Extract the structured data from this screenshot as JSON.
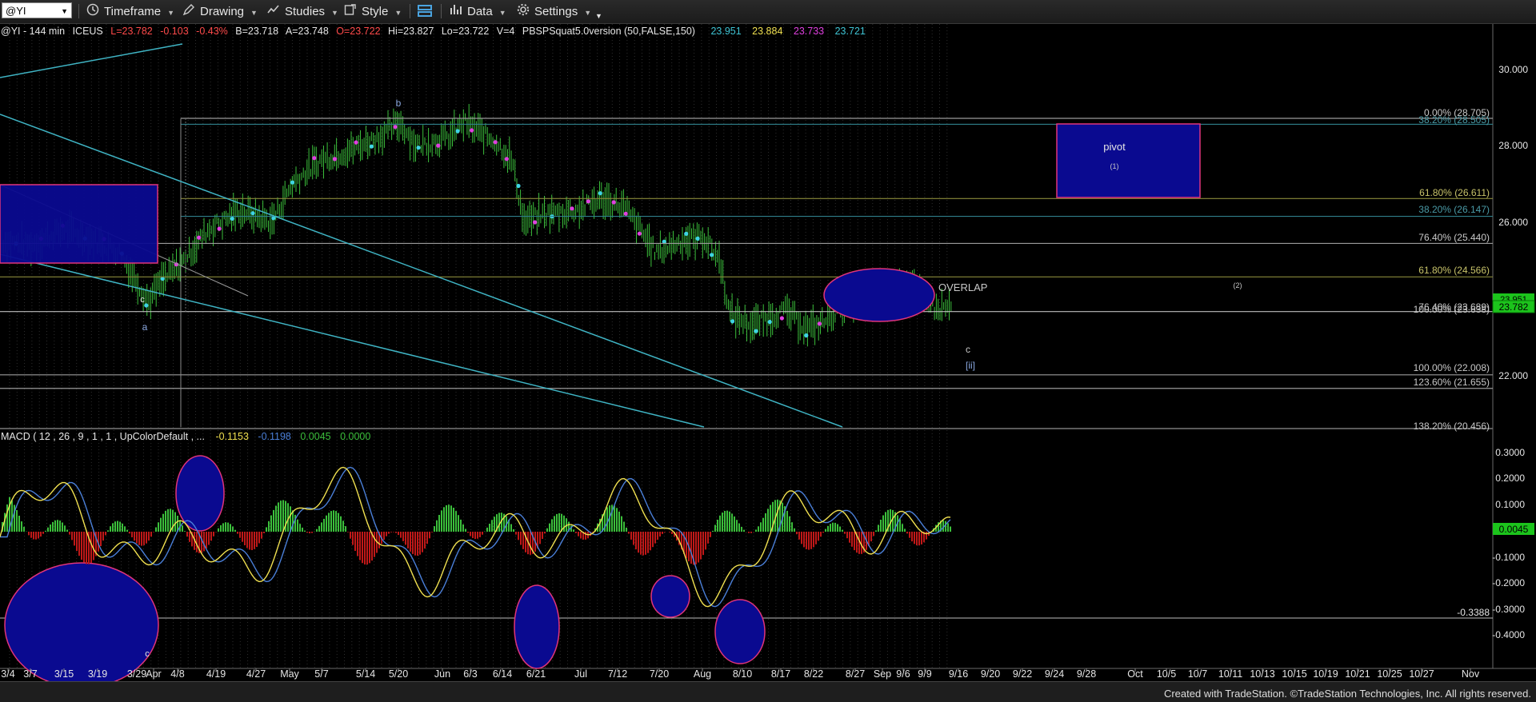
{
  "toolbar": {
    "symbol": "@YI",
    "timeframe": "Timeframe",
    "drawing": "Drawing",
    "studies": "Studies",
    "style": "Style",
    "data": "Data",
    "settings": "Settings"
  },
  "legend": {
    "symbol": "@YI - 144 min",
    "exchange": "ICEUS",
    "last": "L=23.782",
    "change": "-0.103",
    "change_pct": "-0.43%",
    "bid": "B=23.718",
    "ask": "A=23.748",
    "open": "O=23.722",
    "high": "Hi=23.827",
    "low": "Lo=23.722",
    "volume": "V=4",
    "study": "PBSPSquat5.0version (50,FALSE,150)",
    "v1": "23.951",
    "v2": "23.884",
    "v3": "23.733",
    "v4": "23.721"
  },
  "macd_legend": {
    "label": "MACD ( 12 , 26 , 9 , 1 , 1 , UpColorDefault , ...",
    "v1": "-0.1153",
    "v2": "-0.1198",
    "v3": "0.0045",
    "v4": "0.0000"
  },
  "price_axis": [
    "30.000",
    "28.000",
    "26.000",
    "22.000"
  ],
  "price_tags": {
    "upper": "23.951",
    "last": "23.782"
  },
  "macd_axis": [
    "0.3000",
    "0.2000",
    "0.1000",
    "-0.1000",
    "-0.2000",
    "-0.3000",
    "-0.4000"
  ],
  "macd_tag": "0.0045",
  "macd_level": "-0.3388",
  "fib_labels": [
    "0.00% (28.705)",
    "38.20% (28.505)",
    "61.80% (26.611)",
    "38.20% (26.147)",
    "76.40% (25.440)",
    "61.80% (24.566)",
    "76.40% (23.689)",
    "100.00% (23.638)",
    "100.00% (22.008)",
    "123.60% (21.655)",
    "138.20% (20.456)"
  ],
  "annotations": {
    "pivot": "pivot",
    "pivot_sub": "(1)",
    "overlap": "OVERLAP",
    "two": "(2)",
    "b": "b",
    "a": "a",
    "c_left": "c",
    "c": "c",
    "ii": "[ii]",
    "c_macd": "c"
  },
  "x_axis": [
    "3/4",
    "3/7",
    "3/15",
    "3/19",
    "3/29",
    "Apr",
    "4/8",
    "4/19",
    "4/27",
    "May",
    "5/7",
    "5/14",
    "5/20",
    "Jun",
    "6/3",
    "6/14",
    "6/21",
    "Jul",
    "7/12",
    "7/20",
    "Aug",
    "8/10",
    "8/17",
    "8/22",
    "8/27",
    "Sep",
    "9/6",
    "9/9",
    "9/16",
    "9/20",
    "9/22",
    "9/24",
    "9/28",
    "Oct",
    "10/5",
    "10/7",
    "10/11",
    "10/13",
    "10/15",
    "10/19",
    "10/21",
    "10/25",
    "10/27",
    "Nov"
  ],
  "credit": "Created with TradeStation. ©TradeStation Technologies, Inc. All rights reserved.",
  "colors": {
    "bull": "#3bbf3b",
    "bear": "#c01818",
    "macd": "#f0e050",
    "signal": "#4a7fd8",
    "box": "#0a0a90",
    "channel": "#3fb4c4"
  }
}
